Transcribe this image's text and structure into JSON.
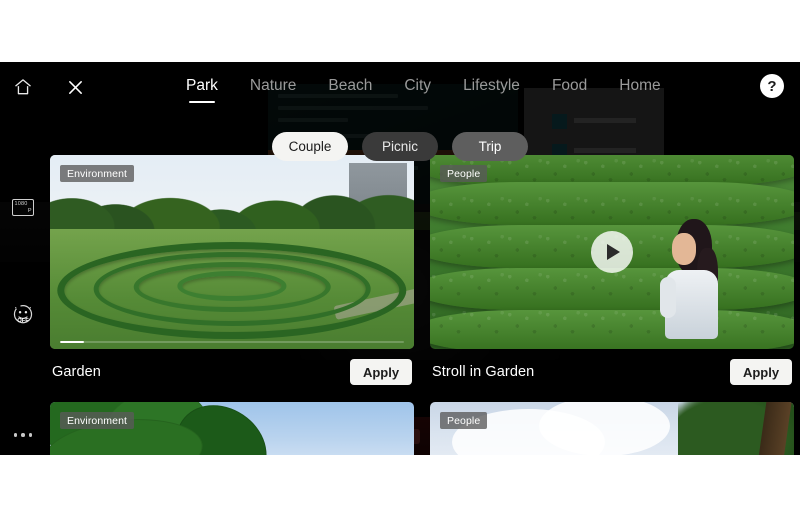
{
  "app": {
    "surface_bg": "#000000",
    "letterbox_color": "#ffffff"
  },
  "topbar": {
    "home_icon": "home-icon",
    "close_icon": "close-icon",
    "help_icon": "help-icon",
    "help_glyph": "?",
    "tabs": [
      {
        "label": "Park",
        "active": true
      },
      {
        "label": "Nature",
        "active": false
      },
      {
        "label": "Beach",
        "active": false
      },
      {
        "label": "City",
        "active": false
      },
      {
        "label": "Lifestyle",
        "active": false
      },
      {
        "label": "Food",
        "active": false
      },
      {
        "label": "Home",
        "active": false
      }
    ]
  },
  "left_rail": {
    "resolution_icon": "resolution-icon",
    "resolution_label": "1080",
    "resolution_sub": "P",
    "beauty_icon": "beauty-face-icon",
    "beauty_state": "OFF",
    "more_icon": "more-options-icon"
  },
  "chips": [
    {
      "label": "Couple",
      "state": "selected"
    },
    {
      "label": "Picnic",
      "state": "normal"
    },
    {
      "label": "Trip",
      "state": "hover"
    }
  ],
  "cards": [
    {
      "badge": "Environment",
      "title": "Garden",
      "apply_label": "Apply",
      "has_play": false,
      "progress_percent": 7,
      "scene": "garden-maze"
    },
    {
      "badge": "People",
      "title": "Stroll in Garden",
      "apply_label": "Apply",
      "has_play": true,
      "progress_percent": 0,
      "scene": "hedge-maze-person"
    },
    {
      "badge": "Environment",
      "title": "",
      "apply_label": "",
      "has_play": false,
      "progress_percent": 0,
      "scene": "palm-sky"
    },
    {
      "badge": "People",
      "title": "",
      "apply_label": "",
      "has_play": false,
      "progress_percent": 0,
      "scene": "clouds-branch"
    }
  ],
  "colors": {
    "chip_selected_bg": "#f4f4f2",
    "chip_normal_bg": "#3a3a3a",
    "chip_hover_bg": "#5e5e5e",
    "apply_bg": "#f4f4f2",
    "tab_active": "#ffffff",
    "tab_inactive": "#9a9a9a",
    "badge_bg": "rgba(90,90,90,.78)"
  }
}
